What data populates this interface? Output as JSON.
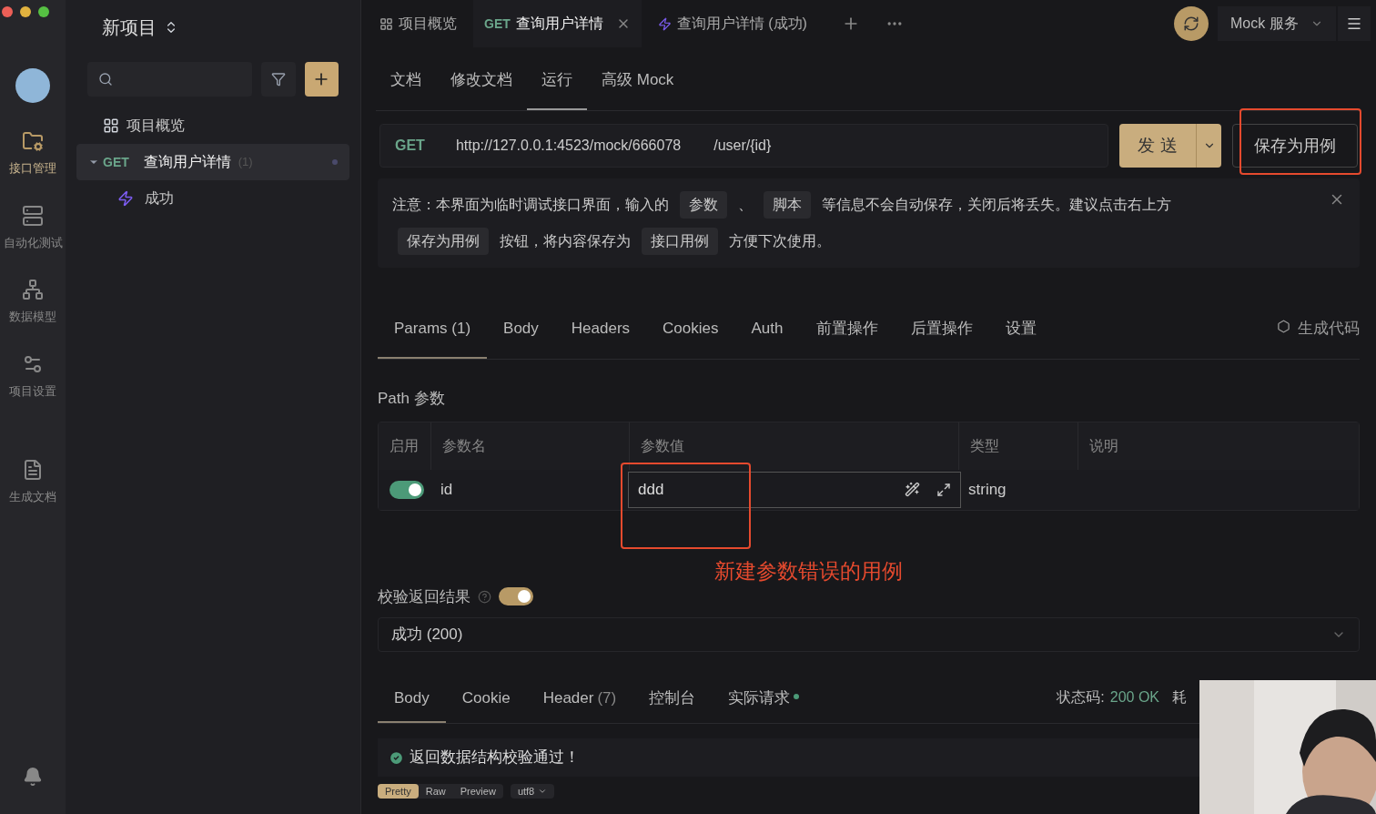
{
  "project": {
    "name": "新项目"
  },
  "rail": [
    {
      "label": "接口管理",
      "selected": true
    },
    {
      "label": "自动化测试",
      "selected": false
    },
    {
      "label": "数据模型",
      "selected": false
    },
    {
      "label": "项目设置",
      "selected": false
    },
    {
      "label": "生成文档",
      "selected": false
    }
  ],
  "tree": [
    {
      "kind": "overview",
      "label": "项目概览",
      "selected": false
    },
    {
      "kind": "endpoint",
      "method": "GET",
      "label": "查询用户详情",
      "count": "(1)",
      "selected": true,
      "expanded": true,
      "children": [
        {
          "kind": "case",
          "label": "成功",
          "selected": false
        }
      ]
    }
  ],
  "top_tabs": [
    {
      "kind": "overview",
      "label": "项目概览",
      "selected": false
    },
    {
      "kind": "endpoint",
      "method": "GET",
      "label": "查询用户详情",
      "selected": true
    },
    {
      "kind": "case",
      "label": "查询用户详情 (成功)",
      "selected": false
    }
  ],
  "service_select": {
    "value": "Mock 服务"
  },
  "sub_tabs": [
    {
      "label": "文档",
      "selected": false
    },
    {
      "label": "修改文档",
      "selected": false
    },
    {
      "label": "运行",
      "selected": true
    },
    {
      "label": "高级 Mock",
      "selected": false
    }
  ],
  "url_bar": {
    "method": "GET",
    "base": "http://127.0.0.1:4523/mock/666078",
    "path": "/user/{id}"
  },
  "send_button": "发 送",
  "save_button": "保存为用例",
  "notice": [
    {
      "kind": "text",
      "text": "注意：本界面为临时调试接口界面，输入的"
    },
    {
      "kind": "chip",
      "text": "参数"
    },
    {
      "kind": "text",
      "text": "、"
    },
    {
      "kind": "chip",
      "text": "脚本"
    },
    {
      "kind": "text",
      "text": "等信息不会自动保存，关闭后将丢失。建议点击右上方"
    },
    {
      "kind": "chip",
      "text": "保存为用例"
    },
    {
      "kind": "text",
      "text": "按钮，将内容保存为"
    },
    {
      "kind": "chip",
      "text": "接口用例"
    },
    {
      "kind": "text",
      "text": "方便下次使用。"
    }
  ],
  "request_tabs": [
    {
      "label": "Params (1)",
      "selected": true
    },
    {
      "label": "Body",
      "selected": false
    },
    {
      "label": "Headers",
      "selected": false
    },
    {
      "label": "Cookies",
      "selected": false
    },
    {
      "label": "Auth",
      "selected": false
    },
    {
      "label": "前置操作",
      "selected": false
    },
    {
      "label": "后置操作",
      "selected": false
    },
    {
      "label": "设置",
      "selected": false
    }
  ],
  "generate_code": "生成代码",
  "path_params": {
    "title": "Path 参数",
    "columns": [
      "启用",
      "参数名",
      "参数值",
      "类型",
      "说明"
    ],
    "rows": [
      {
        "on": true,
        "name": "id",
        "value": "ddd",
        "type": "string"
      }
    ]
  },
  "annotation": "新建参数错误的用例",
  "validate": {
    "label": "校验返回结果",
    "on": true
  },
  "response_select": {
    "value": "成功 (200)"
  },
  "response_tabs": [
    {
      "label": "Body",
      "selected": true,
      "dot": false
    },
    {
      "label": "Cookie",
      "selected": false,
      "dot": false
    },
    {
      "label": "Header",
      "count": "(7)",
      "selected": false,
      "dot": false
    },
    {
      "label": "控制台",
      "selected": false,
      "dot": false
    },
    {
      "label": "实际请求",
      "selected": false,
      "dot": true
    }
  ],
  "status": {
    "label": "状态码:",
    "value": "200 OK",
    "extra": "耗"
  },
  "validation_message": "返回数据结构校验通过！",
  "format_tabs": [
    {
      "label": "Pretty",
      "selected": true
    },
    {
      "label": "Raw",
      "selected": false
    },
    {
      "label": "Preview",
      "selected": false
    }
  ],
  "encoding": "utf8"
}
